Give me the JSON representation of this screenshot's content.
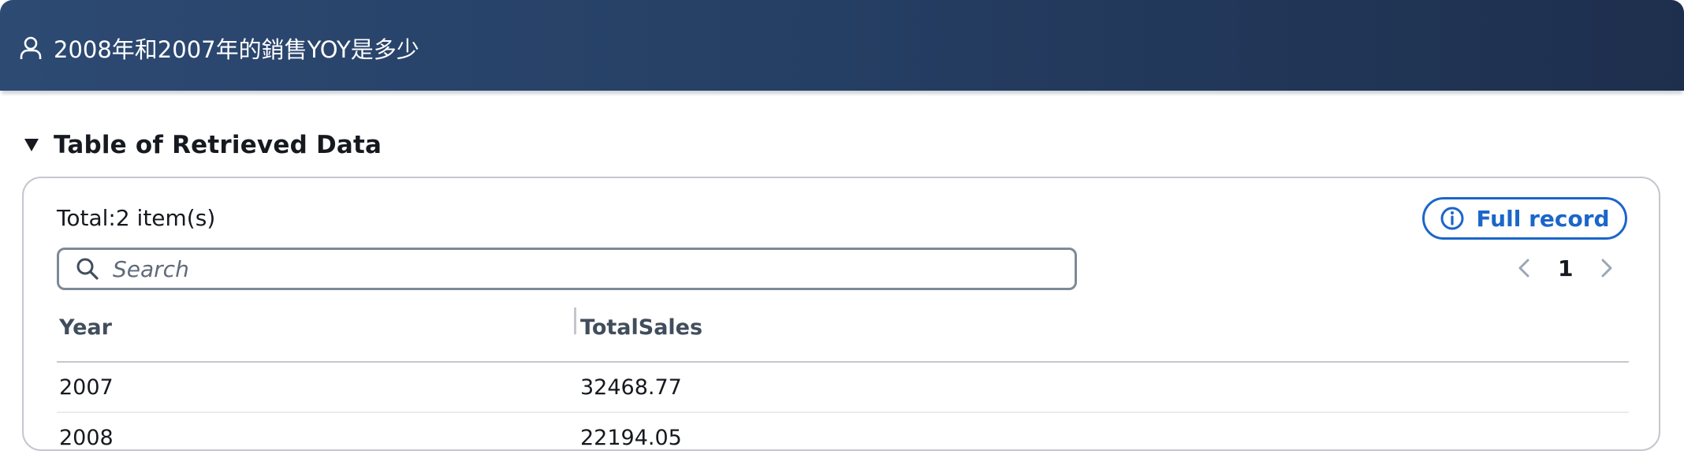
{
  "header": {
    "icon": "user-icon",
    "title": "2008年和2007年的銷售YOY是多少"
  },
  "section": {
    "icon": "triangle-down-icon",
    "title": "Table of Retrieved Data"
  },
  "panel": {
    "total_text": "Total:2 item(s)",
    "full_record": {
      "icon": "info-icon",
      "label": "Full record"
    },
    "search": {
      "placeholder": "Search",
      "value": ""
    },
    "pagination": {
      "current_page": "1"
    },
    "table": {
      "columns": [
        "Year",
        "TotalSales"
      ],
      "rows": [
        [
          "2007",
          "32468.77"
        ],
        [
          "2008",
          "22194.05"
        ]
      ]
    }
  },
  "colors": {
    "header_start": "#2d4a73",
    "header_end": "#1e2f4d",
    "accent": "#1b66c9"
  }
}
